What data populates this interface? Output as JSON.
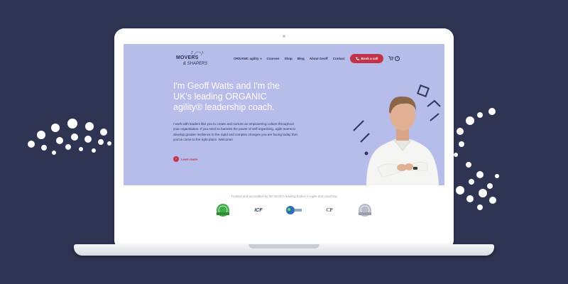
{
  "colors": {
    "background": "#2f3452",
    "hero": "#b6bdea",
    "accent": "#c2334a",
    "headline": "#ffffff",
    "dots": "#ffffff"
  },
  "site": {
    "logo_line1": "MOVERS",
    "logo_line2": "& SHAPERS",
    "nav": {
      "items": [
        "ORGANIC agility",
        "Courses",
        "Shop",
        "Blog",
        "About Geoff",
        "Contact"
      ],
      "book_label": "Book a call",
      "phone_icon": "phone-icon",
      "cart_icon": "cart-icon",
      "cart_count": "0"
    },
    "hero": {
      "headline": "I'm Geoff Watts and I'm the UK's leading ORGANIC agility® leadership coach.",
      "body": "I work with leaders like you to create and nurture an empowering culture throughout your organisation. If you need to harness the power of self-organising, agile teams to develop greater resilience to the rapid and complex changes you are facing today then you've come to the right place. Welcome!",
      "learn_more": "Learn more"
    },
    "trust": {
      "text": "Trusted and accredited by the World's leading bodies in agile and coaching",
      "badges": [
        "ICF",
        "CP"
      ]
    }
  }
}
